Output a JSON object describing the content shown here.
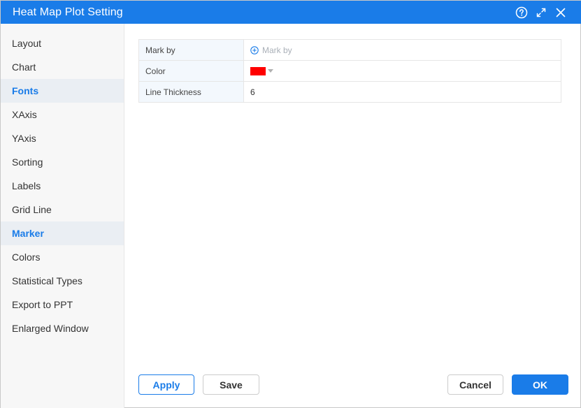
{
  "window": {
    "title": "Heat Map Plot Setting",
    "icons": [
      "help-icon",
      "expand-icon",
      "close-icon"
    ]
  },
  "sidebar": {
    "items": [
      {
        "label": "Layout"
      },
      {
        "label": "Chart"
      },
      {
        "label": "Fonts"
      },
      {
        "label": "XAxis"
      },
      {
        "label": "YAxis"
      },
      {
        "label": "Sorting"
      },
      {
        "label": "Labels"
      },
      {
        "label": "Grid Line"
      },
      {
        "label": "Marker"
      },
      {
        "label": "Colors"
      },
      {
        "label": "Statistical Types"
      },
      {
        "label": "Export to PPT"
      },
      {
        "label": "Enlarged Window"
      }
    ],
    "active": "Marker"
  },
  "properties": {
    "mark_by": {
      "label": "Mark by",
      "placeholder": "Mark by"
    },
    "color": {
      "label": "Color",
      "value": "#ff0000"
    },
    "line_thickness": {
      "label": "Line Thickness",
      "value": "6"
    }
  },
  "footer": {
    "apply": "Apply",
    "save": "Save",
    "cancel": "Cancel",
    "ok": "OK"
  },
  "colors": {
    "accent": "#1a7ce8",
    "title_bar": "#1a7ce8"
  }
}
